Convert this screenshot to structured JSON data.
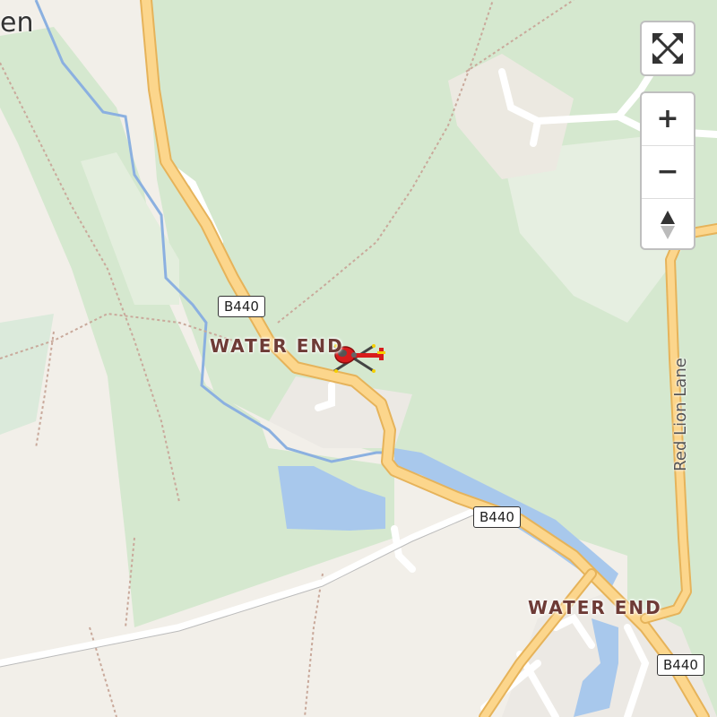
{
  "map": {
    "edge_label_left": "en",
    "places": [
      {
        "id": "water-end-1",
        "name": "WATER END"
      },
      {
        "id": "water-end-2",
        "name": "WATER END"
      }
    ],
    "roads": [
      {
        "id": "b440-1",
        "ref": "B440"
      },
      {
        "id": "b440-2",
        "ref": "B440"
      },
      {
        "id": "b440-3",
        "ref": "B440"
      }
    ],
    "streets": [
      {
        "id": "red-lion-lane",
        "name": "Red Lion Lane"
      }
    ],
    "marker": {
      "icon": "helicopter-icon",
      "color": "#d81c1c"
    }
  },
  "controls": {
    "fullscreen": {
      "icon": "fullscreen-icon"
    },
    "zoom_in": {
      "label": "+"
    },
    "zoom_out": {
      "label": "−"
    },
    "compass": {
      "icon": "compass-icon"
    }
  },
  "colors": {
    "forest": "#d5e8cf",
    "land": "#f2efe9",
    "water": "#a8c8ec",
    "river": "#8bb0e0",
    "road_fill": "#fcd68c",
    "road_casing": "#e6b35a",
    "place_label": "#6e3b36"
  }
}
